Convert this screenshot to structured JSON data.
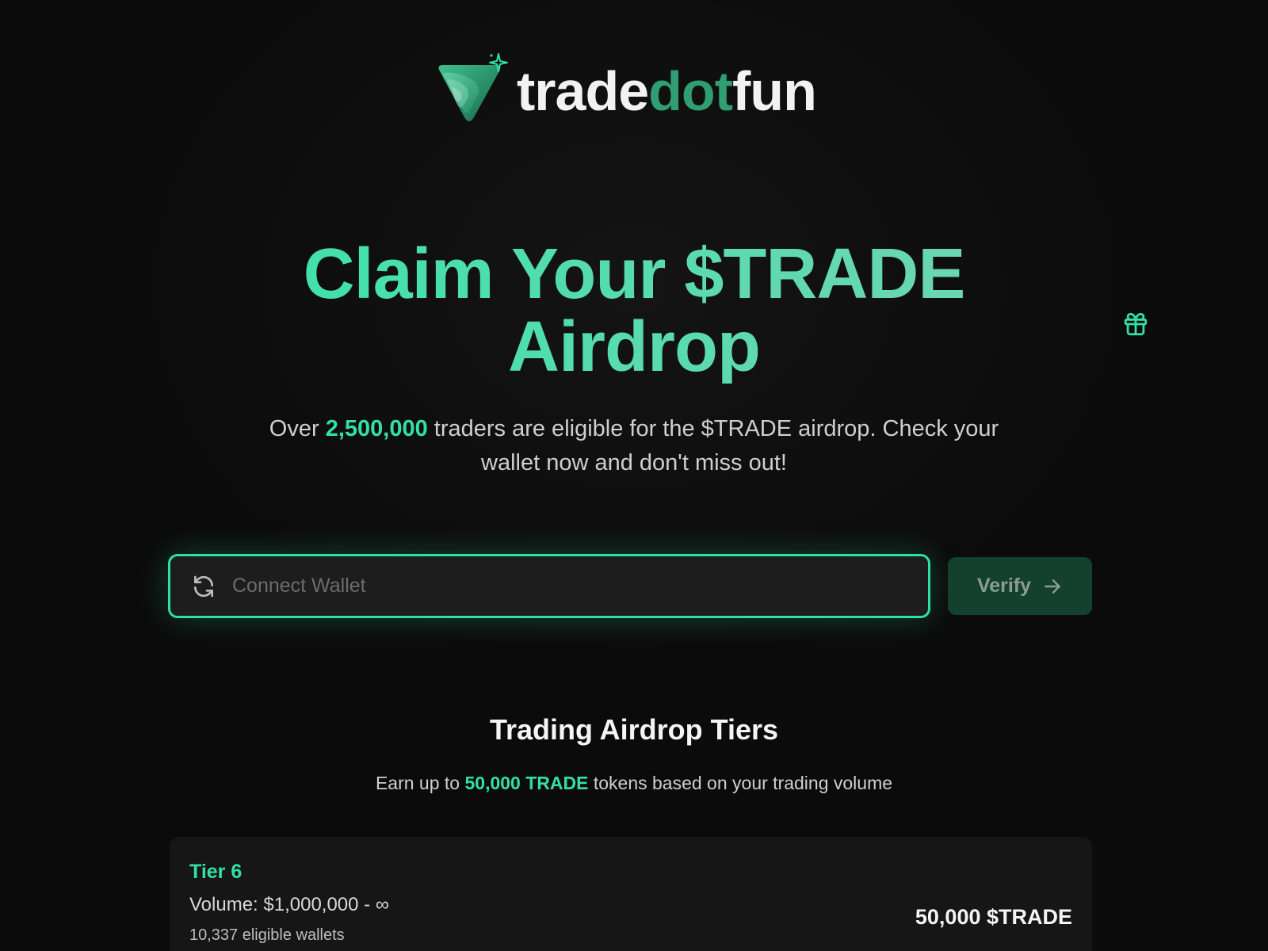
{
  "logo": {
    "part1": "trade",
    "part2": "dot",
    "part3": "fun"
  },
  "hero": {
    "title_line1": "Claim Your $TRADE",
    "title_line2": "Airdrop",
    "sub_prefix": "Over ",
    "sub_highlight": "2,500,000",
    "sub_suffix": " traders are eligible for the $TRADE airdrop. Check your wallet now and don't miss out!"
  },
  "wallet": {
    "placeholder": "Connect Wallet",
    "value": ""
  },
  "verify": {
    "label": "Verify"
  },
  "tiers": {
    "title": "Trading Airdrop Tiers",
    "sub_prefix": "Earn up to ",
    "sub_highlight": "50,000 TRADE",
    "sub_suffix": " tokens based on your trading volume",
    "items": [
      {
        "name": "Tier 6",
        "volume": "Volume: $1,000,000 - ∞",
        "wallets": "10,337 eligible wallets",
        "reward": "50,000 $TRADE"
      }
    ]
  },
  "colors": {
    "accent": "#2ee0a4",
    "logo_dot": "#2f9e72",
    "button_bg": "#14402f",
    "background": "#0b0b0b"
  },
  "icons": {
    "logo": "triangle-logo-icon",
    "sparkle": "sparkle-icon",
    "gift": "gift-icon",
    "refresh": "refresh-icon",
    "arrow": "arrow-right-icon"
  }
}
